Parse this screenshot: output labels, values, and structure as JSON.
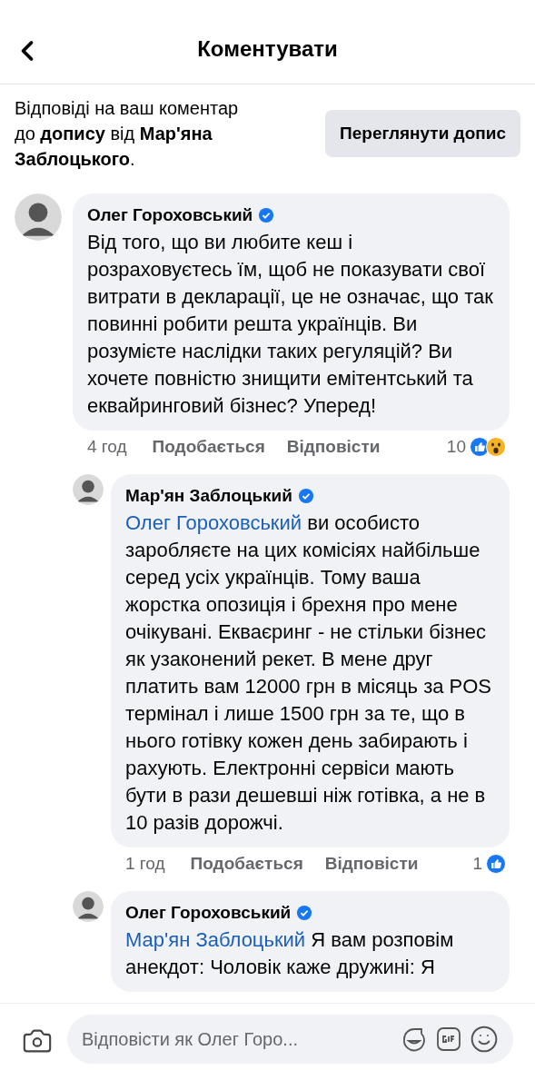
{
  "header": {
    "title": "Коментувати"
  },
  "banner": {
    "text": "Відповіді на ваш коментар до **допису** від **Мар'яна Заблоцького**.",
    "button": "Переглянути допис"
  },
  "comments": [
    {
      "author": "Олег Гороховський",
      "verified": true,
      "text": "Від того, що ви любите кеш і розраховуєтесь їм, щоб не показувати свої витрати в декларації, це не означає, що так повинні робити решта українців. Ви розумієте наслідки таких регуляцій? Ви хочете повністю знищити емітентський та еквайринговий бізнес? Уперед!",
      "time": "4 год",
      "like": "Подобається",
      "reply": "Відповісти",
      "count": "10",
      "reactions": [
        {
          "kind": "like"
        },
        {
          "kind": "wow"
        }
      ],
      "replies": [
        {
          "author": "Мар'ян Заблоцький",
          "verified": true,
          "mention": "Олег Гороховський",
          "text": "ви особисто заробляєте на цих комісіях найбільше серед усіх українців. Тому ваша жорстка опозиція і брехня про мене очікувані. Екваєринг - не стільки бізнес як узаконений рекет. В мене друг платить вам 12000 грн в місяць за POS термінал і лише 1500 грн за те, що в нього готівку кожен день забирають і рахують. Електронні сервіси мають бути в рази дешевші ніж готівка, а не в 10 разів дорожчі.",
          "time": "1 год",
          "like": "Подобається",
          "reply": "Відповісти",
          "count": "1",
          "reactions": [
            {
              "kind": "like"
            }
          ]
        },
        {
          "author": "Олег Гороховський",
          "verified": true,
          "mention": "Мар'ян Заблоцький",
          "text": "Я вам розповім анекдот: Чоловік каже дружині: Я"
        }
      ]
    }
  ],
  "composer": {
    "placeholder": "Відповісти як Олег Горо..."
  }
}
